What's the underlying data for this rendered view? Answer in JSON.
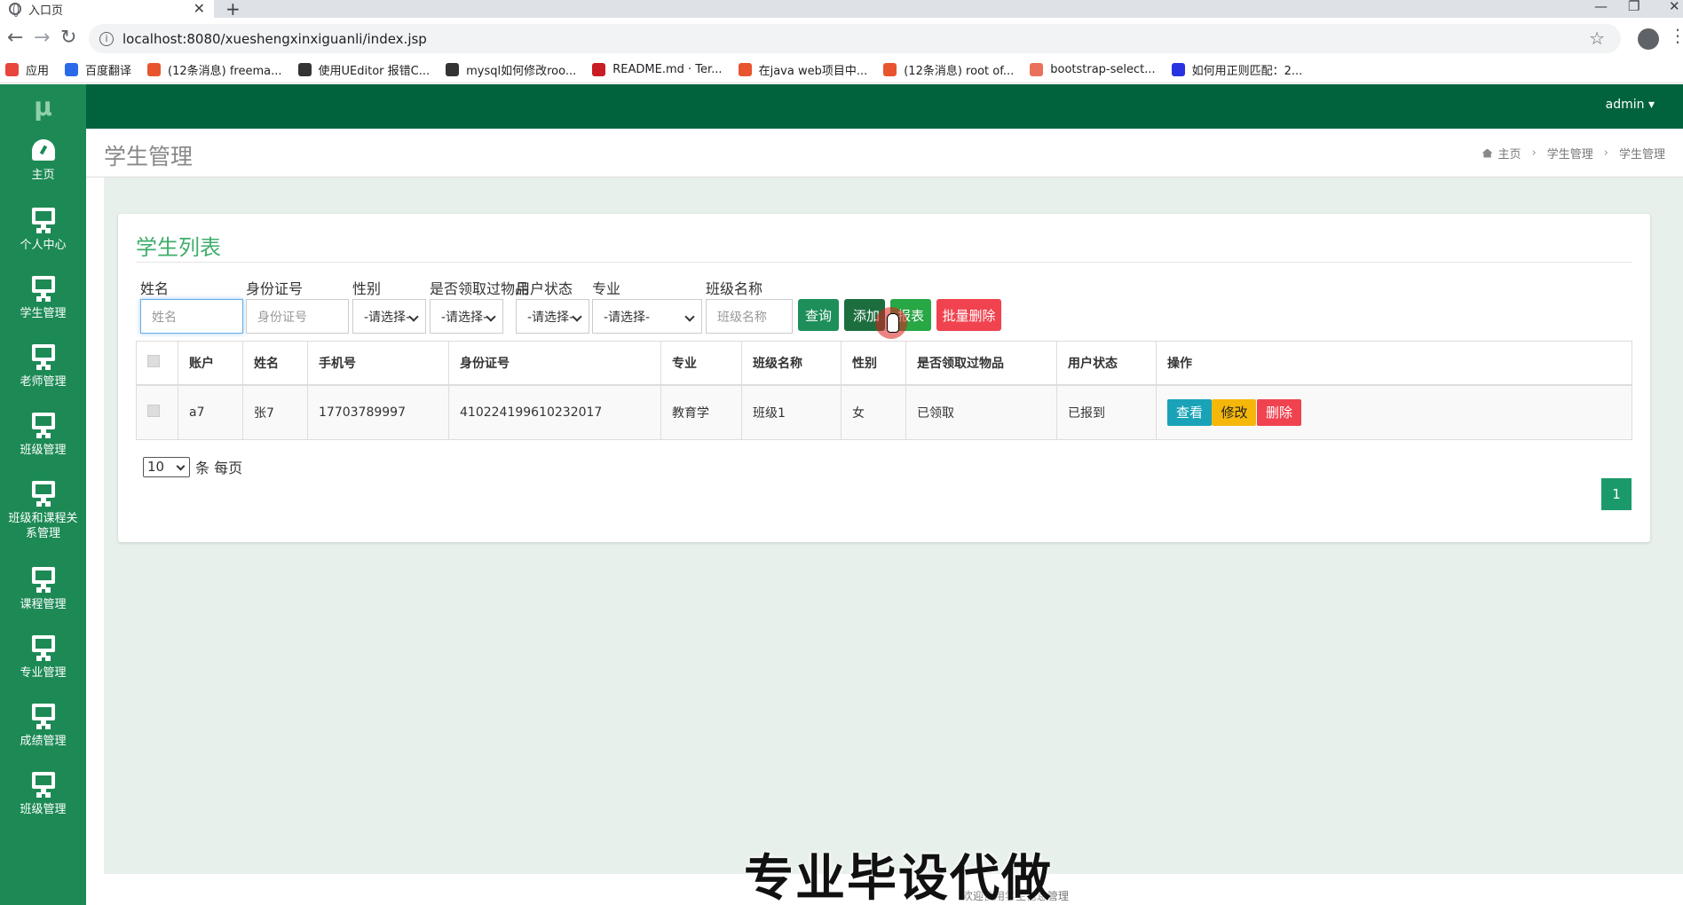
{
  "browser": {
    "tab_title": "入口页",
    "url": "localhost:8080/xueshengxinxiguanli/index.jsp",
    "bookmarks": [
      {
        "label": "应用",
        "icon": "apps-grid-icon",
        "color": "#e8453c"
      },
      {
        "label": "百度翻译",
        "icon": "baidu-translate-icon",
        "color": "#2a6ae9"
      },
      {
        "label": "(12条消息) freema...",
        "icon": "csdn-icon",
        "color": "#e8542e"
      },
      {
        "label": "使用UEditor 报错C...",
        "icon": "hook-icon",
        "color": "#333333"
      },
      {
        "label": "mysql如何修改roo...",
        "icon": "hook-icon",
        "color": "#333333"
      },
      {
        "label": "README.md · Ter...",
        "icon": "gitee-icon",
        "color": "#c71d23"
      },
      {
        "label": "在java web项目中...",
        "icon": "csdn-icon",
        "color": "#e8542e"
      },
      {
        "label": "(12条消息) root of...",
        "icon": "csdn-icon",
        "color": "#e8542e"
      },
      {
        "label": "bootstrap-select...",
        "icon": "jianshu-icon",
        "color": "#e9705a"
      },
      {
        "label": "如何用正则匹配：2...",
        "icon": "baidu-paw-icon",
        "color": "#2932e1"
      }
    ]
  },
  "app": {
    "logo": "μ",
    "user_menu": "admin ▾",
    "sidebar": [
      {
        "label": "主页",
        "icon": "dashboard-icon"
      },
      {
        "label": "个人中心",
        "icon": "monitor-icon"
      },
      {
        "label": "学生管理",
        "icon": "monitor-icon"
      },
      {
        "label": "老师管理",
        "icon": "monitor-icon"
      },
      {
        "label": "班级管理",
        "icon": "monitor-icon"
      },
      {
        "label": "班级和课程关系管理",
        "icon": "monitor-icon"
      },
      {
        "label": "课程管理",
        "icon": "monitor-icon"
      },
      {
        "label": "专业管理",
        "icon": "monitor-icon"
      },
      {
        "label": "成绩管理",
        "icon": "monitor-icon"
      },
      {
        "label": "班级管理",
        "icon": "monitor-icon"
      }
    ],
    "page_title": "学生管理",
    "breadcrumb": [
      "主页",
      "学生管理",
      "学生管理"
    ]
  },
  "card": {
    "title": "学生列表",
    "filters": {
      "name": {
        "label": "姓名",
        "placeholder": "姓名"
      },
      "idcard": {
        "label": "身份证号",
        "placeholder": "身份证号"
      },
      "gender": {
        "label": "性别",
        "value": "-请选择-"
      },
      "received": {
        "label": "是否领取过物品",
        "value": "-请选择-"
      },
      "status": {
        "label": "用户状态",
        "value": "-请选择-"
      },
      "major": {
        "label": "专业",
        "value": "-请选择-"
      },
      "classname": {
        "label": "班级名称",
        "placeholder": "班级名称"
      }
    },
    "buttons": {
      "query": "查询",
      "add": "添加",
      "report": "报表",
      "batch_delete": "批量删除"
    },
    "table": {
      "headers": [
        "账户",
        "姓名",
        "手机号",
        "身份证号",
        "专业",
        "班级名称",
        "性别",
        "是否领取过物品",
        "用户状态",
        "操作"
      ],
      "rows": [
        {
          "account": "a7",
          "name": "张7",
          "phone": "17703789997",
          "idcard": "410224199610232017",
          "major": "教育学",
          "classname": "班级1",
          "gender": "女",
          "received": "已领取",
          "status": "已报到",
          "actions": [
            "查看",
            "修改",
            "删除"
          ]
        }
      ]
    },
    "pager": {
      "page_size": "10",
      "per_page_label": "条 每页",
      "current_page": "1"
    }
  },
  "footer": {
    "text": "欢迎使用学生信息管理"
  },
  "watermark": "专业毕设代做",
  "colors": {
    "topbar": "#00633e",
    "sidebar": "#1d8a55",
    "query_btn": "#1e8f5b",
    "add_btn": "#1c6e3f",
    "report_btn": "#28a745",
    "delete_btn": "#f0434f",
    "view_btn": "#1aa3b8",
    "edit_btn": "#f5b80a",
    "page_active": "#1a9a6a"
  }
}
